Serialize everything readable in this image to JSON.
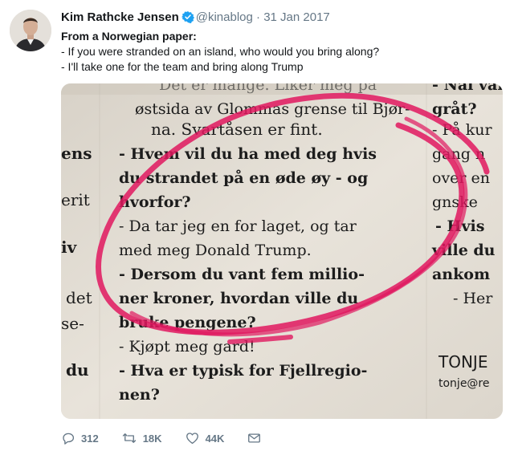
{
  "author": {
    "name": "Kim Rathcke Jensen",
    "handle": "@kinablog",
    "separator": "·",
    "date": "31 Jan 2017"
  },
  "tweet": {
    "lines": [
      "From a Norwegian paper:",
      "- If you were stranded on an island, who would you bring along?",
      "- I'll take one for the team and bring along Trump"
    ]
  },
  "clipping": {
    "left_column": [
      "ens",
      "erit",
      "iv",
      "det",
      "se-",
      "du"
    ],
    "center_column": [
      "Det er mange. Liker meg på",
      "østsida av Glommas grense til Bjør-",
      "na. Svartåsen er fint.",
      "- Hvem vil du ha med deg hvis",
      "du strandet på en øde øy - og",
      "hvorfor?",
      "- Da tar jeg en for laget, og tar",
      "med meg Donald Trump.",
      "- Dersom du vant fem millio-",
      "ner kroner, hvordan ville du",
      "bruke pengene?",
      "- Kjøpt meg gard!",
      "- Hva er typisk for Fjellregio-",
      "nen?"
    ],
    "right_column": [
      "- Nai vai",
      "gråt?",
      "- På kur",
      "gang n",
      "over en",
      "gnske",
      "- Hvis",
      "ville du",
      "ankom",
      "- Her"
    ],
    "byline_name": "TONJE",
    "byline_email": "tonje@re"
  },
  "actions": {
    "replies": "312",
    "retweets": "18K",
    "likes": "44K"
  },
  "colors": {
    "verified": "#1da1f2",
    "text_secondary": "#657786",
    "marker": "#e0185f"
  },
  "icons": [
    "verified-badge-icon",
    "reply-icon",
    "retweet-icon",
    "like-icon",
    "message-icon"
  ]
}
